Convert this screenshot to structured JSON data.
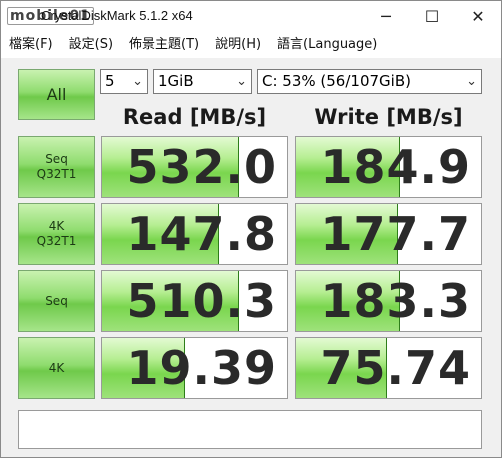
{
  "window": {
    "logo_text": "mobile01",
    "title": "CrystalDiskMark 5.1.2 x64",
    "min_glyph": "─",
    "max_glyph": "☐",
    "close_glyph": "✕"
  },
  "menu": [
    "檔案(F)",
    "設定(S)",
    "佈景主題(T)",
    "說明(H)",
    "語言(Language)"
  ],
  "controls": {
    "all_label": "All",
    "count": "5",
    "size": "1GiB",
    "drive": "C: 53% (56/107GiB)",
    "arrow": "⌄"
  },
  "headers": {
    "read": "Read [MB/s]",
    "write": "Write [MB/s]"
  },
  "rows": [
    {
      "label": "Seq\nQ32T1",
      "read": "532.0",
      "write": "184.9",
      "read_fill": 0.74,
      "write_fill": 0.56
    },
    {
      "label": "4K\nQ32T1",
      "read": "147.8",
      "write": "177.7",
      "read_fill": 0.63,
      "write_fill": 0.55
    },
    {
      "label": "Seq",
      "read": "510.3",
      "write": "183.3",
      "read_fill": 0.74,
      "write_fill": 0.56
    },
    {
      "label": "4K",
      "read": "19.39",
      "write": "75.74",
      "read_fill": 0.45,
      "write_fill": 0.49
    }
  ],
  "comment": ""
}
